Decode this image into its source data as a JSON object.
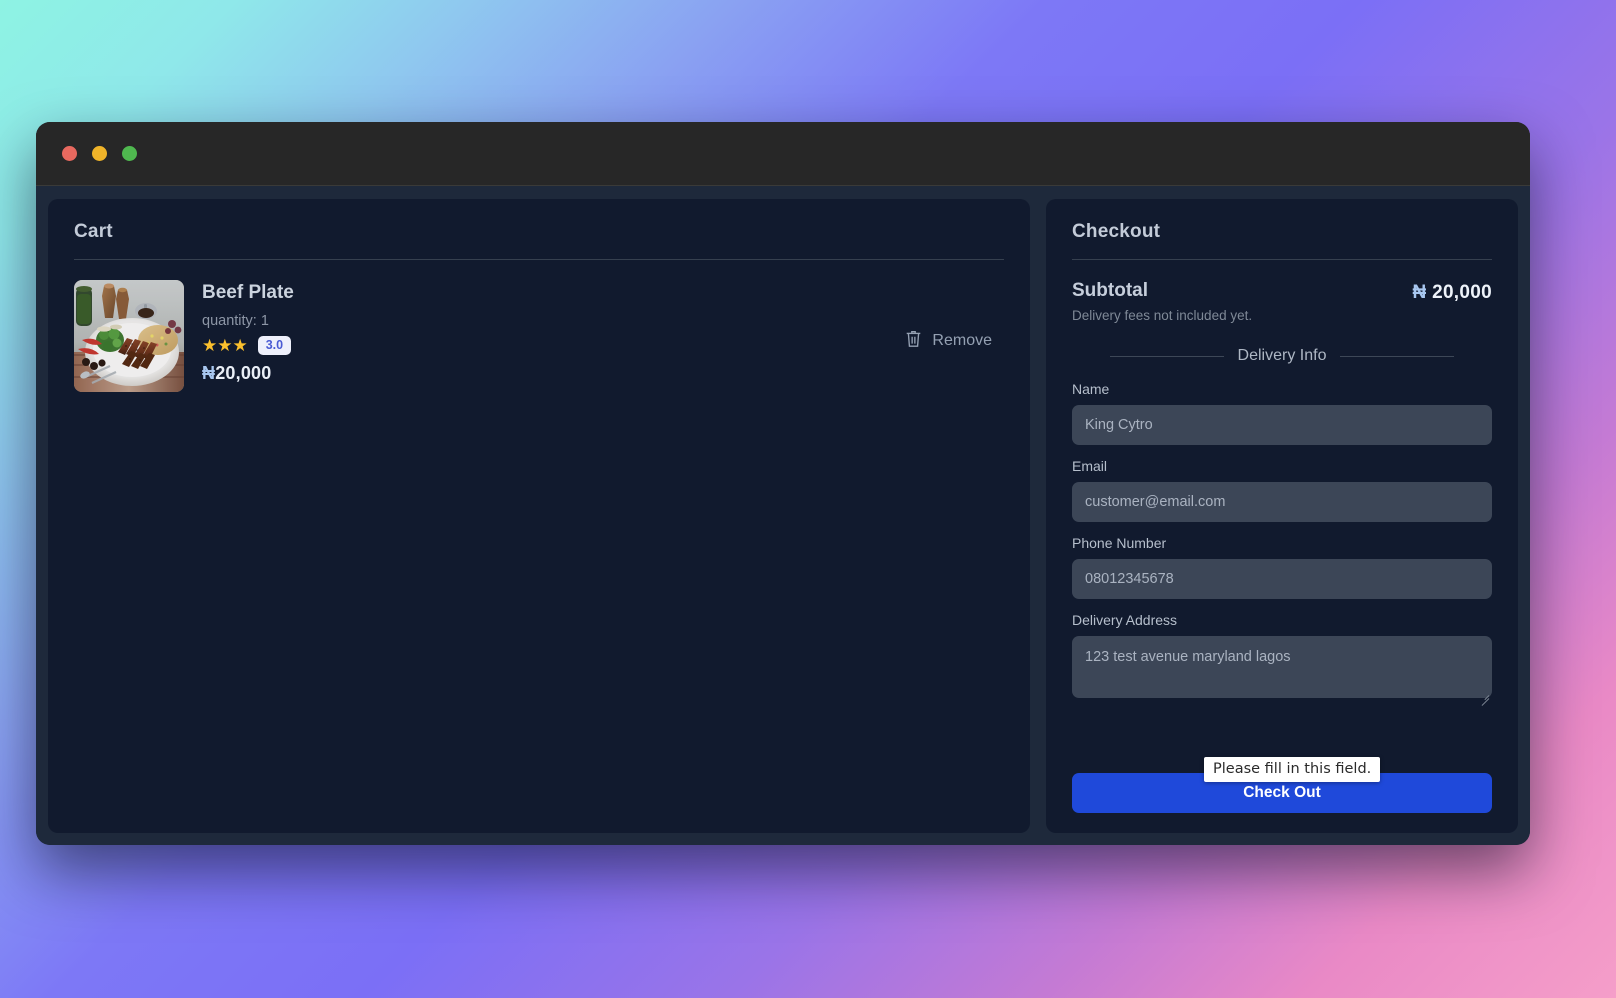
{
  "window": {
    "traffic_lights": [
      "close",
      "minimize",
      "maximize"
    ]
  },
  "cart": {
    "title": "Cart",
    "items": [
      {
        "name": "Beef Plate",
        "quantity_label": "quantity: 1",
        "stars": "★★★",
        "rating_badge": "3.0",
        "currency": "₦",
        "price": "20,000",
        "remove_label": "Remove",
        "image_alt": "beef-plate-photo"
      }
    ]
  },
  "checkout": {
    "title": "Checkout",
    "subtotal_label": "Subtotal",
    "subtotal_note": "Delivery fees not included yet.",
    "subtotal_currency": "₦",
    "subtotal_amount": "20,000",
    "divider_label": "Delivery Info",
    "fields": [
      {
        "label": "Name",
        "placeholder": "King Cytro",
        "value": ""
      },
      {
        "label": "Email",
        "placeholder": "customer@email.com",
        "value": ""
      },
      {
        "label": "Phone Number",
        "placeholder": "08012345678",
        "value": ""
      },
      {
        "label": "Delivery Address",
        "placeholder": "123 test avenue maryland lagos",
        "value": ""
      }
    ],
    "submit_label": "Check Out"
  },
  "tooltip": {
    "message": "Please fill in this field."
  },
  "colors": {
    "accent_blue": "#1f49da",
    "badge_text": "#4a5bd4",
    "badge_bg": "#eef0fb",
    "star": "#fbc02d",
    "panel_bg": "#111a2e",
    "window_bg": "#1e293b",
    "titlebar_bg": "#272727",
    "input_bg": "#3c4657",
    "traffic_red": "#e8695f",
    "traffic_yellow": "#f0b429",
    "traffic_green": "#4fb84f"
  }
}
